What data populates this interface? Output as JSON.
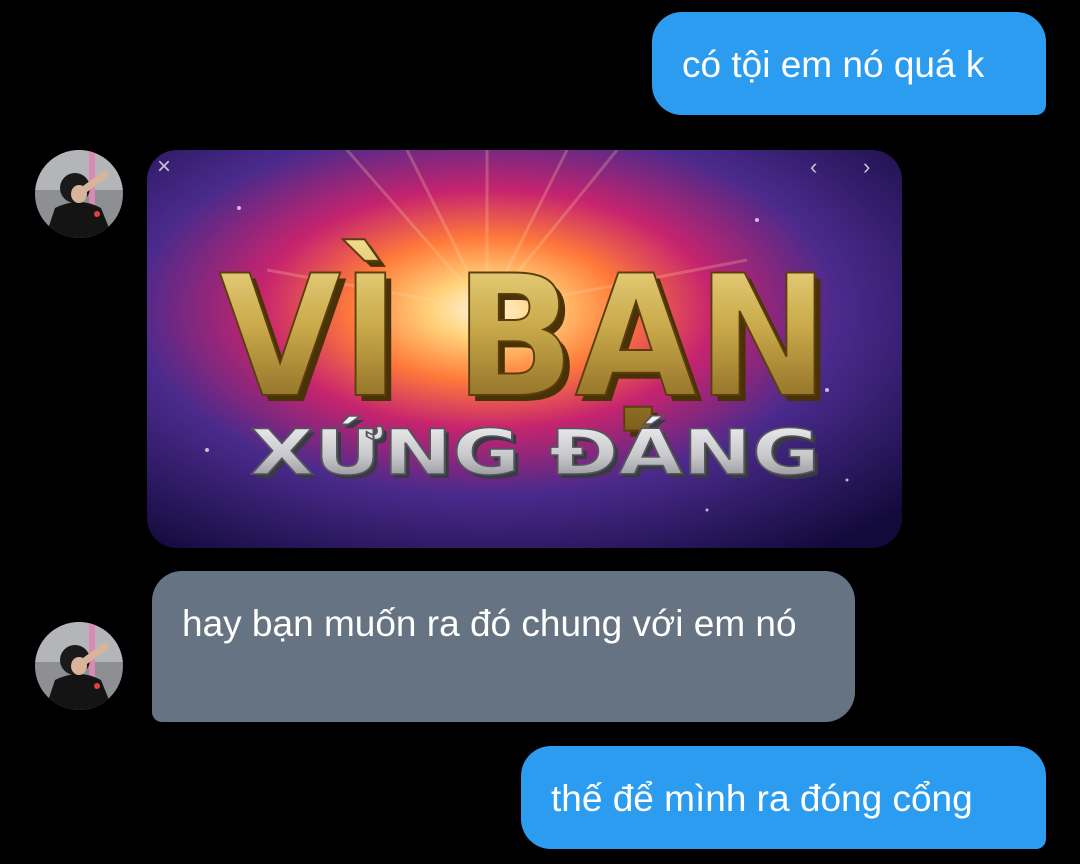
{
  "chat": {
    "messages": [
      {
        "id": "msg1",
        "direction": "outgoing",
        "text": "có tội em nó quá k"
      },
      {
        "id": "msg2",
        "direction": "incoming",
        "type": "image",
        "image_text": {
          "line1": "VÌ BẠN",
          "line2": "XỨNG ĐÁNG"
        }
      },
      {
        "id": "msg3",
        "direction": "incoming",
        "text": "hay bạn muốn ra đó chung với em nó"
      },
      {
        "id": "msg4",
        "direction": "outgoing",
        "text": "thế để mình ra đóng cổng"
      }
    ]
  },
  "image_controls": {
    "close": "×",
    "prev": "‹",
    "next": "›"
  },
  "icons": {
    "close": "close-icon",
    "prev": "chevron-left-icon",
    "next": "chevron-right-icon"
  },
  "colors": {
    "background": "#000000",
    "outgoing_bubble": "#2b9cf0",
    "incoming_bubble": "#667382",
    "text": "#ffffff",
    "title_gold": "#c9a94a",
    "title_silver": "#c8c8cc"
  }
}
